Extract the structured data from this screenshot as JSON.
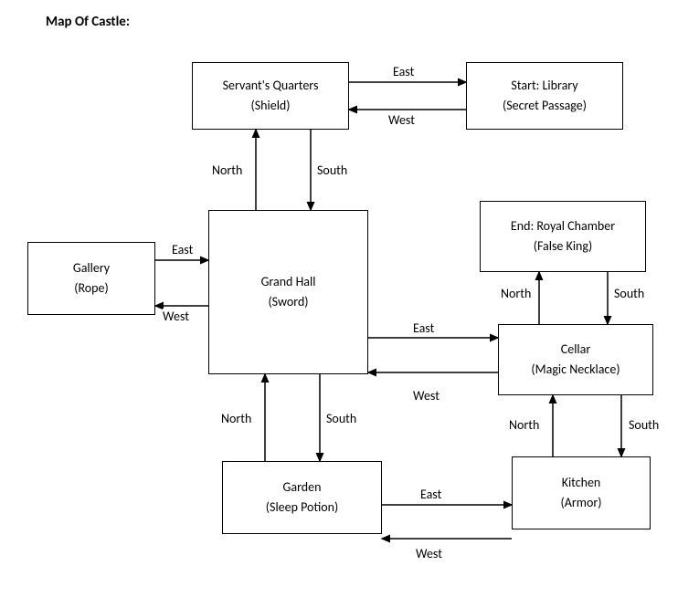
{
  "title": "Map Of Castle:",
  "rooms": {
    "servants": {
      "name": "Servant's Quarters",
      "item": "(Shield)"
    },
    "library": {
      "name": "Start:   Library",
      "item": "(Secret Passage)"
    },
    "gallery": {
      "name": "Gallery",
      "item": "(Rope)"
    },
    "grand": {
      "name": "Grand Hall",
      "item": "(Sword)"
    },
    "royal": {
      "name": "End:   Royal Chamber",
      "item": "(False King)"
    },
    "cellar": {
      "name": "Cellar",
      "item": "(Magic Necklace)"
    },
    "garden": {
      "name": "Garden",
      "item": "(Sleep Potion)"
    },
    "kitchen": {
      "name": "Kitchen",
      "item": "(Armor)"
    }
  },
  "dirs": {
    "north": "North",
    "south": "South",
    "east": "East",
    "west": "West"
  },
  "edges": [
    {
      "from": "servants",
      "to": "library",
      "forward": "East",
      "back": "West"
    },
    {
      "from": "servants",
      "to": "grand",
      "forward": "South",
      "back": "North"
    },
    {
      "from": "gallery",
      "to": "grand",
      "forward": "East",
      "back": "West"
    },
    {
      "from": "grand",
      "to": "cellar",
      "forward": "East",
      "back": "West"
    },
    {
      "from": "grand",
      "to": "garden",
      "forward": "South",
      "back": "North"
    },
    {
      "from": "cellar",
      "to": "royal",
      "forward": "North",
      "back": "South"
    },
    {
      "from": "cellar",
      "to": "kitchen",
      "forward": "South",
      "back": "North"
    },
    {
      "from": "garden",
      "to": "kitchen",
      "forward": "East",
      "back": "West"
    }
  ]
}
